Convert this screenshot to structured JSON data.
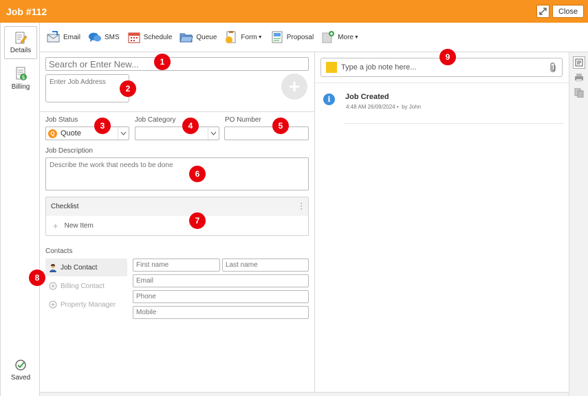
{
  "window": {
    "title": "Job #112",
    "close_label": "Close"
  },
  "sidebar": {
    "items": [
      {
        "label": "Details",
        "icon": "edit-document-icon"
      },
      {
        "label": "Billing",
        "icon": "billing-document-icon"
      }
    ],
    "saved_label": "Saved"
  },
  "toolbar": {
    "buttons": [
      {
        "label": "Email",
        "icon": "email-icon"
      },
      {
        "label": "SMS",
        "icon": "sms-icon"
      },
      {
        "label": "Schedule",
        "icon": "calendar-icon"
      },
      {
        "label": "Queue",
        "icon": "folder-icon"
      },
      {
        "label": "Form",
        "icon": "form-icon"
      },
      {
        "label": "Proposal",
        "icon": "proposal-icon"
      },
      {
        "label": "More",
        "icon": "add-more-icon"
      }
    ]
  },
  "form": {
    "search_placeholder": "Search or Enter New...",
    "address_placeholder": "Enter Job Address",
    "status_label": "Job Status",
    "status_value": "Quote",
    "status_badge": "Q",
    "category_label": "Job Category",
    "category_value": "",
    "po_label": "PO Number",
    "po_value": "",
    "description_label": "Job Description",
    "description_placeholder": "Describe the work that needs to be done",
    "checklist_title": "Checklist",
    "checklist_new_item": "New Item",
    "contacts_label": "Contacts",
    "contact_tabs": [
      "Job Contact",
      "Billing Contact",
      "Property Manager"
    ],
    "first_name_placeholder": "First name",
    "last_name_placeholder": "Last name",
    "email_placeholder": "Email",
    "phone_placeholder": "Phone",
    "mobile_placeholder": "Mobile"
  },
  "notes": {
    "placeholder": "Type a job note here...",
    "activity": [
      {
        "title": "Job Created",
        "time": "4:48 AM 26/09/2024",
        "by": "by John"
      }
    ]
  },
  "markers": [
    "1",
    "2",
    "3",
    "4",
    "5",
    "6",
    "7",
    "8",
    "9"
  ],
  "colors": {
    "accent": "#f7931e",
    "marker": "#e8000c",
    "info": "#3c8fdb"
  }
}
